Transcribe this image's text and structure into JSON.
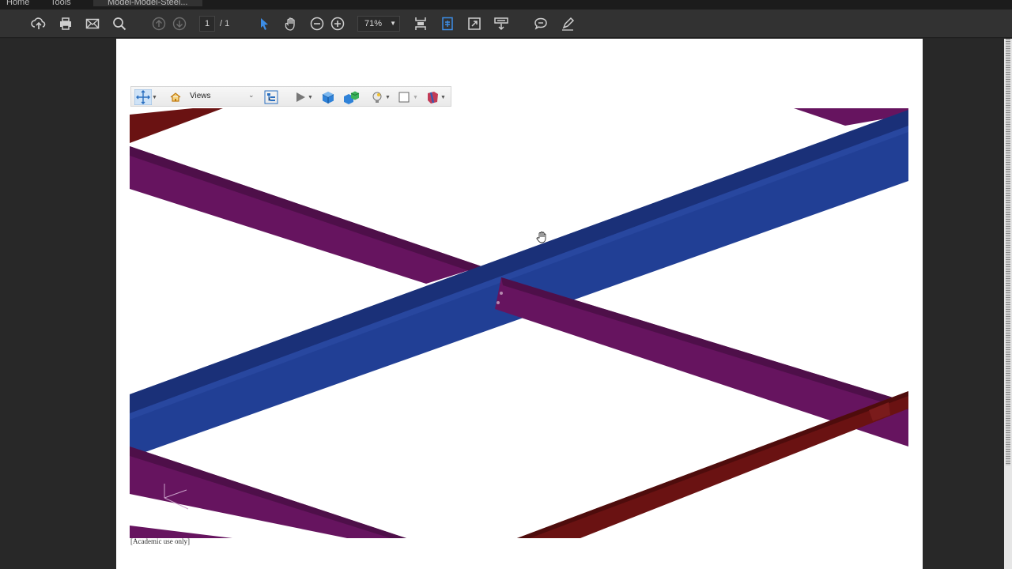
{
  "tabs": {
    "home": "Home",
    "tools": "Tools",
    "document": "Model-Model-Steel..."
  },
  "toolbar": {
    "page_current": "1",
    "page_total": "/ 1",
    "zoom": "71%",
    "icons": [
      "upload-cloud-icon",
      "print-icon",
      "email-icon",
      "search-icon",
      "prev-page-icon",
      "next-page-icon",
      "select-arrow-icon",
      "hand-tool-icon",
      "zoom-out-icon",
      "zoom-in-icon",
      "scroll-mode-icon",
      "fit-page-icon",
      "full-screen-icon",
      "read-mode-icon",
      "comment-icon",
      "sign-pen-icon"
    ]
  },
  "viewer3d": {
    "views_label": "Views",
    "icons": [
      "rotate-tool-icon",
      "home-view-icon",
      "model-tree-icon",
      "play-animation-icon",
      "solid-render-icon",
      "multi-part-icon",
      "lighting-icon",
      "background-color-icon",
      "cross-section-icon"
    ]
  },
  "model": {
    "colors": {
      "blue_beam": "#213f95",
      "purple_beam": "#66145f",
      "red_beam": "#6a1212"
    }
  },
  "watermark": "[Academic use only]"
}
